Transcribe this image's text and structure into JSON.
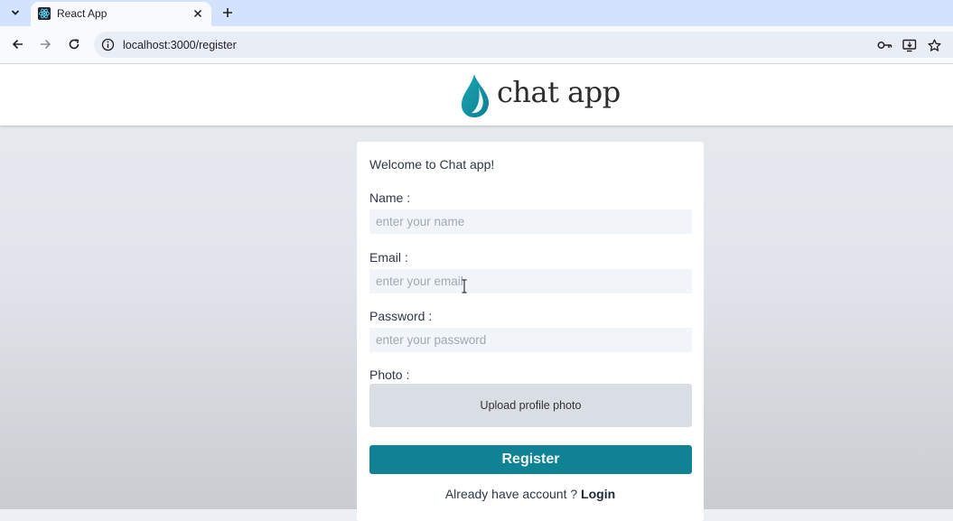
{
  "browser": {
    "tab": {
      "title": "React App",
      "favicon": "react-logo-icon"
    },
    "address": {
      "url": "localhost:3000/register"
    },
    "icons": {
      "tab_menu": "chevron-down-icon",
      "close_tab": "close-icon",
      "new_tab": "plus-icon",
      "back": "arrow-left-icon",
      "forward": "arrow-right-icon",
      "reload": "reload-icon",
      "site_info": "info-icon",
      "passwords": "key-icon",
      "install": "install-app-icon",
      "bookmark": "star-icon"
    }
  },
  "header": {
    "logo_text": "chat app",
    "brand_color": "#1497a8"
  },
  "form": {
    "welcome": "Welcome to Chat app!",
    "name": {
      "label": "Name :",
      "placeholder": "enter your name"
    },
    "email": {
      "label": "Email :",
      "placeholder": "enter your email"
    },
    "password": {
      "label": "Password :",
      "placeholder": "enter your password"
    },
    "photo": {
      "label": "Photo :",
      "upload_text": "Upload profile photo"
    },
    "register_button": "Register",
    "login_prompt": "Already have account ?",
    "login_link": "Login"
  },
  "colors": {
    "accent": "#0f8294",
    "input_bg": "#f1f5f9",
    "upload_bg": "#d9dee4"
  }
}
